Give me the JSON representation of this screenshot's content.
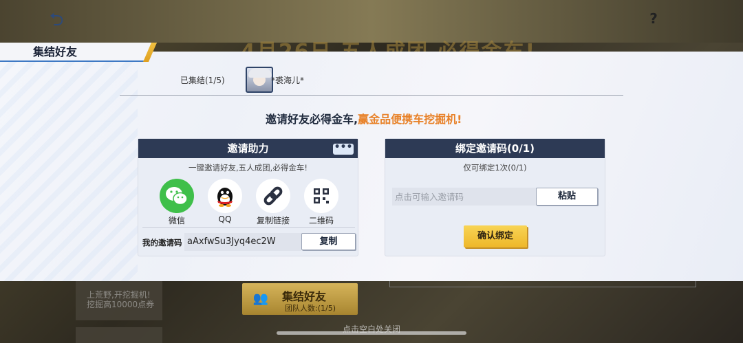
{
  "background": {
    "headline": "4月26日 五人成团 必得金车!",
    "left_card_text": "上荒野,开挖掘机!",
    "left_card_sub": "挖掘高10000点券",
    "gather_button": {
      "title": "集结好友",
      "count": "团队人数:(1/5)"
    },
    "close_hint": "点击空白处关闭"
  },
  "modal": {
    "title": "集结好友",
    "gathered_label": "已集结(1/5)",
    "member_name": "*裘海儿*",
    "slogan_main": "邀请好友必得金车,",
    "slogan_highlight": "赢金品便携车挖掘机!",
    "invite_panel": {
      "title": "邀请助力",
      "more": "•••",
      "subtitle": "一键邀请好友,五人成团,必得金车!",
      "share_options": [
        {
          "label": "微信",
          "icon": "wechat-icon"
        },
        {
          "label": "QQ",
          "icon": "qq-icon"
        },
        {
          "label": "复制链接",
          "icon": "link-icon"
        },
        {
          "label": "二维码",
          "icon": "qrcode-icon"
        }
      ],
      "code_label": "我的邀请码",
      "code_value": "aAxfwSu3Jyq4ec2W",
      "copy_button": "复制"
    },
    "bind_panel": {
      "title": "绑定邀请码(0/1)",
      "subtitle": "仅可绑定1次(0/1)",
      "input_placeholder": "点击可输入邀请码",
      "paste_button": "粘贴",
      "confirm_button": "确认绑定"
    }
  },
  "colors": {
    "panel_header": "#2d3a55",
    "highlight": "#e8822a",
    "confirm": "#f2c440",
    "wechat": "#3fbf4a"
  }
}
